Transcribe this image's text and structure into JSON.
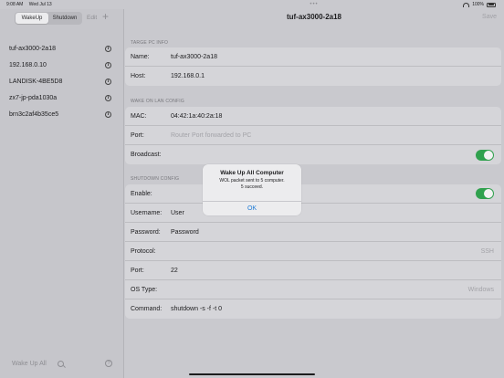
{
  "status": {
    "time": "9:08 AM",
    "date": "Wed Jul 13",
    "battery": "100%"
  },
  "sidebar": {
    "segments": [
      "WakeUp",
      "Shutdown"
    ],
    "edit_label": "Edit",
    "add_label": "+",
    "hosts": [
      "tuf-ax3000-2a18",
      "192.168.0.10",
      "LANDISK-4BE5D8",
      "zx7-jp-pda1030a",
      "brn3c2af4b35ce5"
    ],
    "footer": {
      "wake_all_label": "Wake Up All",
      "help_label": "?"
    }
  },
  "main": {
    "title": "tuf-ax3000-2a18",
    "save_label": "Save",
    "target": {
      "header": "TARGE PC INFO",
      "name_label": "Name:",
      "name_value": "tuf-ax3000-2a18",
      "host_label": "Host:",
      "host_value": "192.168.0.1"
    },
    "wol": {
      "header": "WAKE ON LAN CONFIG",
      "mac_label": "MAC:",
      "mac_value": "04:42:1a:40:2a:18",
      "port_label": "Port:",
      "port_placeholder": "Router Port forwarded to PC",
      "broadcast_label": "Broadcast:",
      "broadcast_on": true
    },
    "shutdown": {
      "header": "SHUTDOWN CONFIG",
      "enable_label": "Enable:",
      "enable_on": true,
      "username_label": "Username:",
      "username_value": "User",
      "password_label": "Password:",
      "password_value": "Password",
      "protocol_label": "Protocol:",
      "protocol_value": "SSH",
      "port_label": "Port:",
      "port_value": "22",
      "os_label": "OS Type:",
      "os_value": "Windows",
      "command_label": "Command:",
      "command_value": "shutdown -s -f -t 0"
    }
  },
  "alert": {
    "title": "Wake Up All Computer",
    "message_line1": "WOL packet sent to 5 computer.",
    "message_line2": "5 succeed.",
    "ok_label": "OK"
  },
  "colors": {
    "toggle_on": "#30a14e",
    "accent": "#1e7bd6"
  }
}
